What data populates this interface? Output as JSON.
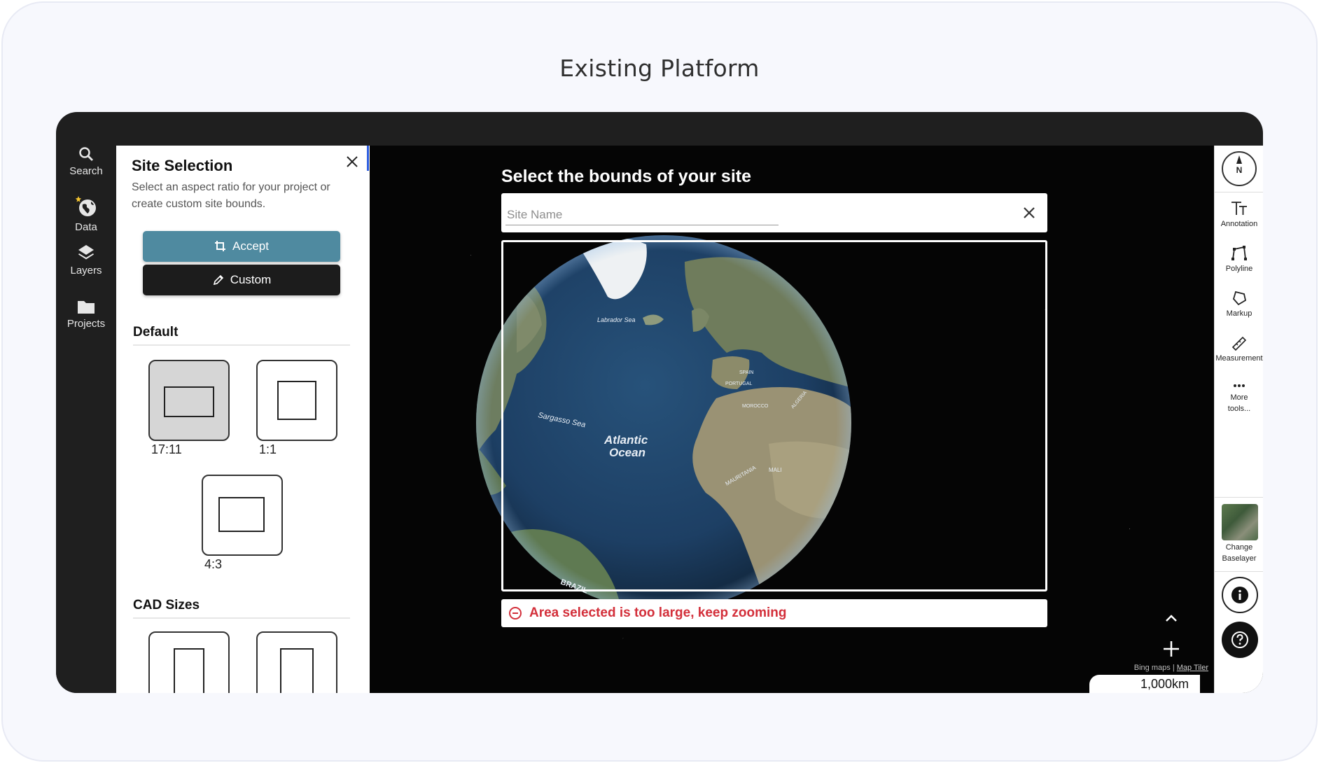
{
  "page": {
    "heading": "Existing Platform"
  },
  "rail": {
    "items": [
      {
        "label": "Search",
        "icon": "search-icon"
      },
      {
        "label": "Data",
        "icon": "globe-icon"
      },
      {
        "label": "Layers",
        "icon": "layers-icon"
      },
      {
        "label": "Projects",
        "icon": "folder-icon"
      }
    ]
  },
  "panel": {
    "title": "Site Selection",
    "description": "Select an aspect ratio for your project or create custom site bounds.",
    "accept_label": "Accept",
    "custom_label": "Custom",
    "default_section": "Default",
    "cad_section": "CAD Sizes",
    "ratios": [
      {
        "label": "17:11",
        "selected": true
      },
      {
        "label": "1:1",
        "selected": false
      },
      {
        "label": "4:3",
        "selected": false
      }
    ]
  },
  "map": {
    "heading": "Select the bounds of your site",
    "site_name_placeholder": "Site Name",
    "site_name_value": "",
    "error": "Area selected is too large, keep zooming",
    "labels": {
      "labrador": "Labrador Sea",
      "sargasso": "Sargasso Sea",
      "atlantic_1": "Atlantic",
      "atlantic_2": "Ocean",
      "brazil": "BRAZIL",
      "spain": "SPAIN",
      "portugal": "PORTUGAL",
      "morocco": "MOROCCO",
      "algeria": "ALGERIA",
      "mauritania": "MAURITANIA",
      "mali": "MALI"
    },
    "credits": {
      "bing": "Bing maps",
      "maptiler": "Map Tiler"
    },
    "scale": "1,000km"
  },
  "toolbar": {
    "compass": "N",
    "tools": [
      {
        "label": "Annotation",
        "icon": "text-icon"
      },
      {
        "label": "Polyline",
        "icon": "polyline-icon"
      },
      {
        "label": "Markup",
        "icon": "markup-icon"
      },
      {
        "label": "Measurement",
        "icon": "ruler-icon"
      },
      {
        "label": "More tools...",
        "icon": "more-icon"
      }
    ],
    "baselayer": "Change Baselayer"
  },
  "colors": {
    "accent": "#4f8aa0",
    "error": "#d32f3a",
    "dark": "#1f1f1f"
  }
}
